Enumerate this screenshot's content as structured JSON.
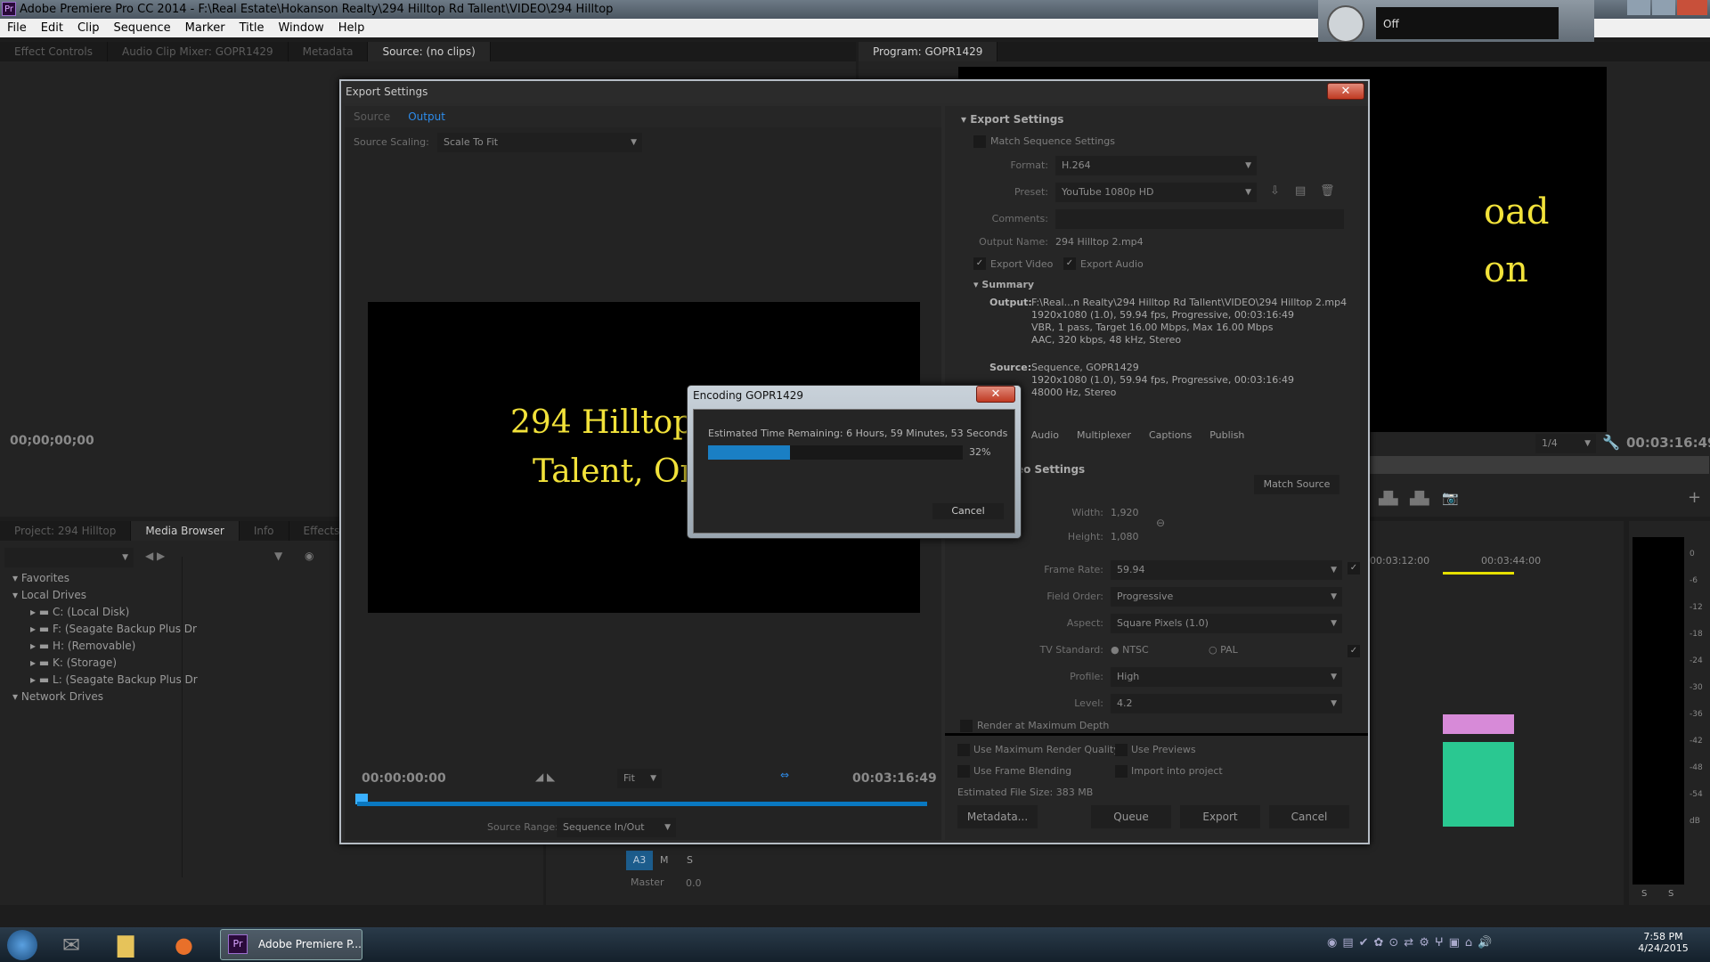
{
  "window": {
    "title": "Adobe Premiere Pro CC 2014 - F:\\Real Estate\\Hokanson Realty\\294 Hilltop Rd Tallent\\VIDEO\\294 Hilltop",
    "logo": "Pr"
  },
  "menu": [
    "File",
    "Edit",
    "Clip",
    "Sequence",
    "Marker",
    "Title",
    "Window",
    "Help"
  ],
  "source_tabs": [
    "Effect Controls",
    "Audio Clip Mixer: GOPR1429",
    "Metadata",
    "Source: (no clips)"
  ],
  "source_timecode": "00;00;00;00",
  "program": {
    "tab": "Program: GOPR1429",
    "overlay_text_1": "oad",
    "overlay_text_2": "on",
    "zoom": "1/4",
    "timecode": "00:03:16:49"
  },
  "recorder": {
    "status": "Off"
  },
  "project_tabs": [
    "Project: 294 Hilltop",
    "Media Browser",
    "Info",
    "Effects"
  ],
  "media_browser": {
    "favorites": "Favorites",
    "local_drives": "Local Drives",
    "drives": [
      "C: (Local Disk)",
      "F: (Seagate Backup Plus Dr",
      "H: (Removable)",
      "K: (Storage)",
      "L: (Seagate Backup Plus Dr"
    ],
    "network_drives": "Network Drives"
  },
  "timeline": {
    "ticks": [
      "00:03:12:00",
      "00:03:44:00"
    ],
    "track": "A3",
    "m": "M",
    "s": "S",
    "master": "Master",
    "master_value": "0.0"
  },
  "meter": {
    "scale": [
      "0",
      "-6",
      "-12",
      "-18",
      "-24",
      "-30",
      "-36",
      "-42",
      "-48",
      "-54",
      "dB"
    ],
    "bottom": [
      "S",
      "S"
    ]
  },
  "export": {
    "title": "Export Settings",
    "tabs": [
      "Source",
      "Output"
    ],
    "source_scaling_label": "Source Scaling:",
    "source_scaling": "Scale To Fit",
    "preview_text_1": "294 Hilltop",
    "preview_text_2": "Talent, Or",
    "time_in": "00:00:00:00",
    "time_out": "00:03:16:49",
    "fit": "Fit",
    "source_range_label": "Source Range:",
    "source_range": "Sequence In/Out",
    "section": "Export Settings",
    "match_sequence": "Match Sequence Settings",
    "format_label": "Format:",
    "format": "H.264",
    "preset_label": "Preset:",
    "preset": "YouTube 1080p HD",
    "comments_label": "Comments:",
    "output_name_label": "Output Name:",
    "output_name": "294 Hilltop 2.mp4",
    "export_video": "Export Video",
    "export_audio": "Export Audio",
    "summary": "Summary",
    "output_label": "Output:",
    "output_lines": [
      "F:\\Real...n Realty\\294 Hilltop Rd Tallent\\VIDEO\\294 Hilltop 2.mp4",
      "1920x1080 (1.0), 59.94 fps, Progressive, 00:03:16:49",
      "VBR, 1 pass, Target 16.00 Mbps, Max 16.00 Mbps",
      "AAC, 320 kbps, 48 kHz, Stereo"
    ],
    "source_label": "Source:",
    "source_lines": [
      "Sequence, GOPR1429",
      "1920x1080 (1.0), 59.94 fps, Progressive, 00:03:16:49",
      "48000 Hz, Stereo"
    ],
    "settings_tabs": [
      "o",
      "Audio",
      "Multiplexer",
      "Captions",
      "Publish"
    ],
    "video_settings": "eo Settings",
    "match_source": "Match Source",
    "width_label": "Width:",
    "width": "1,920",
    "height_label": "Height:",
    "height": "1,080",
    "frame_rate_label": "Frame Rate:",
    "frame_rate": "59.94",
    "field_order_label": "Field Order:",
    "field_order": "Progressive",
    "aspect_label": "Aspect:",
    "aspect": "Square Pixels (1.0)",
    "tv_label": "TV Standard:",
    "ntsc": "NTSC",
    "pal": "PAL",
    "profile_label": "Profile:",
    "profile": "High",
    "level_label": "Level:",
    "level": "4.2",
    "max_depth": "Render at Maximum Depth",
    "max_quality": "Use Maximum Render Quality",
    "previews": "Use Previews",
    "frame_blending": "Use Frame Blending",
    "import": "Import into project",
    "file_size_label": "Estimated File Size:",
    "file_size": "383 MB",
    "metadata": "Metadata...",
    "queue": "Queue",
    "export": "Export",
    "cancel": "Cancel"
  },
  "encoding": {
    "title": "Encoding GOPR1429",
    "remaining": "Estimated Time Remaining: 6 Hours, 59 Minutes, 53 Seconds",
    "percent_label": "32%",
    "progress": 0.32,
    "cancel": "Cancel",
    "bar_color": "#1a7fc4"
  },
  "taskbar": {
    "app": "Adobe Premiere P...",
    "time": "7:58 PM",
    "date": "4/24/2015"
  }
}
